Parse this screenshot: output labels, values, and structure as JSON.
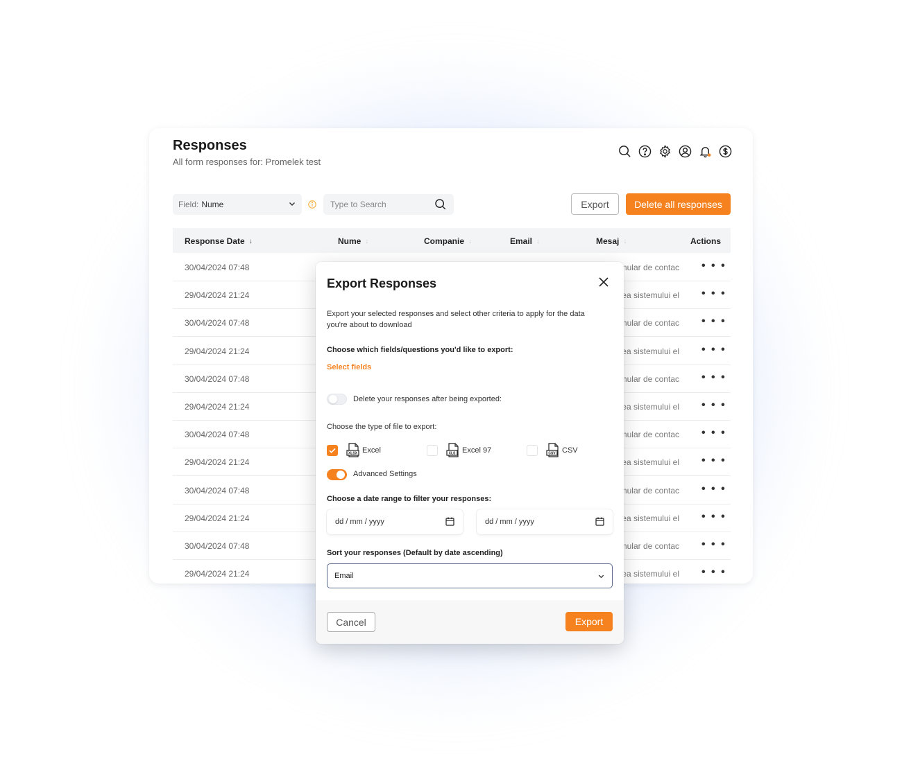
{
  "header": {
    "title": "Responses",
    "subtitle": "All form responses for: Promelek test"
  },
  "top_icons": [
    "search-icon",
    "help-icon",
    "settings-icon",
    "user-icon",
    "bell-icon",
    "billing-icon"
  ],
  "filters": {
    "field_label": "Field:",
    "field_value": "Nume",
    "search_placeholder": "Type to Search"
  },
  "toolbar": {
    "export_label": "Export",
    "delete_all_label": "Delete all responses"
  },
  "table": {
    "headers": [
      "Response Date",
      "Nume",
      "Companie",
      "Email",
      "Mesaj",
      "Actions"
    ],
    "rows": [
      {
        "date": "30/04/2024 07:48",
        "mesaj": "mular de contac"
      },
      {
        "date": "29/04/2024 21:24",
        "mesaj": "ea sistemului el"
      },
      {
        "date": "30/04/2024 07:48",
        "mesaj": "mular de contac"
      },
      {
        "date": "29/04/2024 21:24",
        "mesaj": "ea sistemului el"
      },
      {
        "date": "30/04/2024 07:48",
        "mesaj": "mular de contac"
      },
      {
        "date": "29/04/2024 21:24",
        "mesaj": "ea sistemului el"
      },
      {
        "date": "30/04/2024 07:48",
        "mesaj": "mular de contac"
      },
      {
        "date": "29/04/2024 21:24",
        "mesaj": "ea sistemului el"
      },
      {
        "date": "30/04/2024 07:48",
        "mesaj": "mular de contac"
      },
      {
        "date": "29/04/2024 21:24",
        "mesaj": "ea sistemului el"
      },
      {
        "date": "30/04/2024 07:48",
        "mesaj": "mular de contac"
      },
      {
        "date": "29/04/2024 21:24",
        "mesaj": "ea sistemului el"
      }
    ],
    "actions_label": "• • •"
  },
  "modal": {
    "title": "Export Responses",
    "description": "Export your selected responses and select other criteria to apply for the data you're about to download",
    "choose_fields_label": "Choose which fields/questions you'd like to export:",
    "select_fields_link": "Select fields",
    "delete_after_label": "Delete your responses after being exported:",
    "delete_after_enabled": false,
    "file_type_label": "Choose the type of file to export:",
    "file_types": [
      {
        "label": "Excel",
        "badge": "XLSX",
        "checked": true
      },
      {
        "label": "Excel 97",
        "badge": "XLS",
        "checked": false
      },
      {
        "label": "CSV",
        "badge": "CSV",
        "checked": false
      }
    ],
    "advanced_label": "Advanced Settings",
    "advanced_enabled": true,
    "date_range_label": "Choose a date range to filter your responses:",
    "date_from_placeholder": "dd / mm / yyyy",
    "date_to_placeholder": "dd / mm / yyyy",
    "sort_label": "Sort your responses (Default by date ascending)",
    "sort_value": "Email",
    "cancel_label": "Cancel",
    "export_label": "Export"
  },
  "colors": {
    "accent": "#f5821f",
    "page_bg": "#ffffff"
  }
}
